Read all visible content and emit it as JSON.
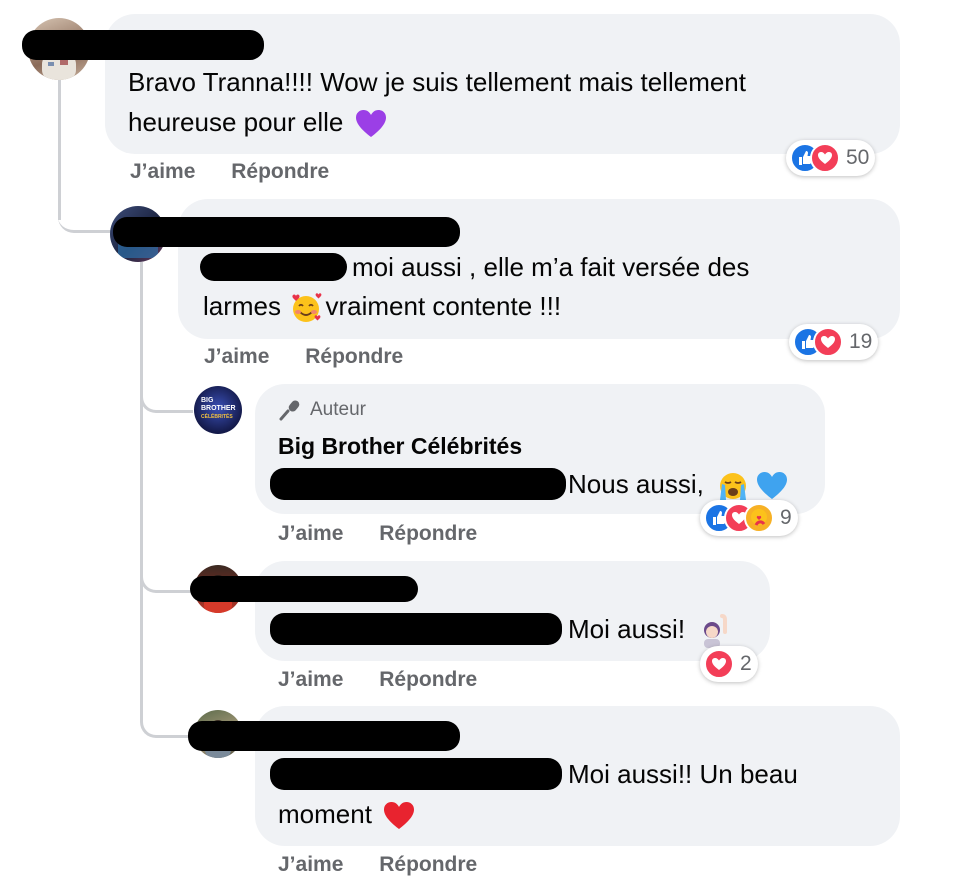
{
  "comments": [
    {
      "text_line1": "Bravo Tranna!!!! Wow je suis tellement mais tellement",
      "text_line2": "heureuse pour elle",
      "like_label": "J’aime",
      "reply_label": "Répondre",
      "reaction_count": "50"
    },
    {
      "text_line1": "moi aussi , elle m’a fait versée des",
      "text_line2": "larmes",
      "text_line2b": "vraiment contente !!!",
      "like_label": "J’aime",
      "reply_label": "Répondre",
      "reaction_count": "19"
    },
    {
      "author_badge": "Auteur",
      "author_name": "Big Brother Célébrités",
      "avatar_text_top": "BIG",
      "avatar_text_mid": "BROTHER",
      "avatar_text_bot": "CÉLÉBRITÉS",
      "text": "Nous aussi,",
      "like_label": "J’aime",
      "reply_label": "Répondre",
      "reaction_count": "9"
    },
    {
      "text": "Moi aussi!",
      "like_label": "J’aime",
      "reply_label": "Répondre",
      "reaction_count": "2"
    },
    {
      "text_line1": "Moi aussi!! Un beau",
      "text_line2": "moment",
      "like_label": "J’aime",
      "reply_label": "Répondre"
    }
  ],
  "colors": {
    "like": "#1b74e4",
    "love": "#f33e58",
    "care": "#f7b125",
    "bubble": "#f0f2f5",
    "secondary_text": "#65676b"
  }
}
